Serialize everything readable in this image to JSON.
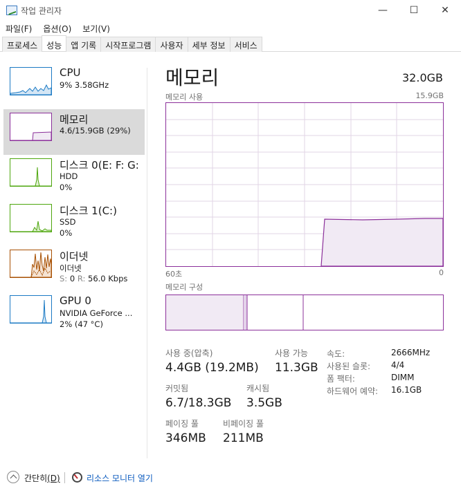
{
  "window": {
    "title": "작업 관리자",
    "minimize_glyph": "—",
    "maximize_glyph": "☐",
    "close_glyph": "✕"
  },
  "menu": [
    "파일(F)",
    "옵션(O)",
    "보기(V)"
  ],
  "tabs": [
    {
      "label": "프로세스",
      "active": false
    },
    {
      "label": "성능",
      "active": true
    },
    {
      "label": "앱 기록",
      "active": false
    },
    {
      "label": "시작프로그램",
      "active": false
    },
    {
      "label": "사용자",
      "active": false
    },
    {
      "label": "세부 정보",
      "active": false
    },
    {
      "label": "서비스",
      "active": false
    }
  ],
  "resources": [
    {
      "title": "CPU",
      "line1": "9% 3.58GHz",
      "line2": "",
      "color": "#1b7ac4",
      "selected": false
    },
    {
      "title": "메모리",
      "line1": "4.6/15.9GB (29%)",
      "line2": "",
      "color": "#8b2f9a",
      "selected": true
    },
    {
      "title": "디스크 0(E: F: G:",
      "line1": "HDD",
      "line2": "0%",
      "color": "#4da60c",
      "selected": false
    },
    {
      "title": "디스크 1(C:)",
      "line1": "SSD",
      "line2": "0%",
      "color": "#4da60c",
      "selected": false
    },
    {
      "title": "이더넷",
      "line1": "이더넷",
      "line2_s": "S:",
      "line2_sv": "0",
      "line2_r": "R:",
      "line2_rv": "56.0 Kbps",
      "color": "#a74f01",
      "selected": false
    },
    {
      "title": "GPU 0",
      "line1": "NVIDIA GeForce ...",
      "line2": "2% (47 °C)",
      "color": "#1b7ac4",
      "selected": false
    }
  ],
  "memory": {
    "title": "메모리",
    "total": "32.0GB",
    "usage_label": "메모리 사용",
    "usage_max": "15.9GB",
    "time_left": "60초",
    "time_right": "0",
    "composition_label": "메모리 구성",
    "usage_fraction_after": 0.29,
    "stats": {
      "in_use_label": "사용 중(압축)",
      "in_use_value": "4.4GB (19.2MB)",
      "available_label": "사용 가능",
      "available_value": "11.3GB",
      "committed_label": "커밋됨",
      "committed_value": "6.7/18.3GB",
      "cached_label": "캐시됨",
      "cached_value": "3.5GB",
      "paged_label": "페이징 풀",
      "paged_value": "346MB",
      "nonpaged_label": "비페이징 풀",
      "nonpaged_value": "211MB"
    },
    "details": [
      {
        "label": "속도:",
        "value": "2666MHz"
      },
      {
        "label": "사용된 슬롯:",
        "value": "4/4"
      },
      {
        "label": "폼 팩터:",
        "value": "DIMM"
      },
      {
        "label": "하드웨어 예약:",
        "value": "16.1GB"
      }
    ]
  },
  "footer": {
    "fewer_label": "간단히",
    "fewer_key": "(D)",
    "resmon_label": "리소스 모니터 열기"
  },
  "colors": {
    "memory": "#8b2f9a",
    "memory_fill": "#f1eaf4",
    "grid": "#e2d4e6"
  }
}
